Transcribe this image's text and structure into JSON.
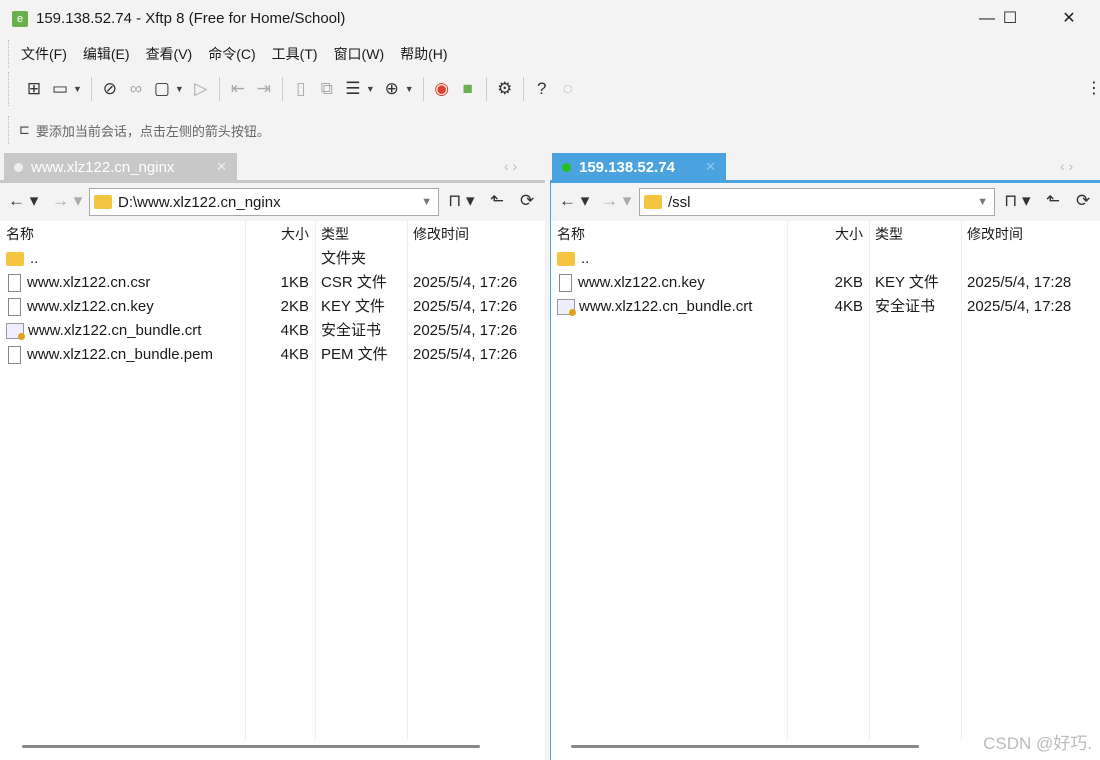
{
  "window": {
    "title": "159.138.52.74 - Xftp 8 (Free for Home/School)",
    "minimize": "—",
    "maximize": "☐",
    "close": "✕"
  },
  "menu": [
    "文件(F)",
    "编辑(E)",
    "查看(V)",
    "命令(C)",
    "工具(T)",
    "窗口(W)",
    "帮助(H)"
  ],
  "hint": "要添加当前会话，点击左侧的箭头按钮。",
  "left": {
    "tab": "www.xlz122.cn_nginx",
    "path": "D:\\www.xlz122.cn_nginx",
    "headers": [
      "名称",
      "大小",
      "类型",
      "修改时间"
    ],
    "rows": [
      {
        "name": "..",
        "size": "",
        "type": "文件夹",
        "time": "",
        "icon": "folder"
      },
      {
        "name": "www.xlz122.cn.csr",
        "size": "1KB",
        "type": "CSR 文件",
        "time": "2025/5/4, 17:26",
        "icon": "file"
      },
      {
        "name": "www.xlz122.cn.key",
        "size": "2KB",
        "type": "KEY 文件",
        "time": "2025/5/4, 17:26",
        "icon": "file"
      },
      {
        "name": "www.xlz122.cn_bundle.crt",
        "size": "4KB",
        "type": "安全证书",
        "time": "2025/5/4, 17:26",
        "icon": "cert"
      },
      {
        "name": "www.xlz122.cn_bundle.pem",
        "size": "4KB",
        "type": "PEM 文件",
        "time": "2025/5/4, 17:26",
        "icon": "file"
      }
    ]
  },
  "right": {
    "tab": "159.138.52.74",
    "path": "/ssl",
    "headers": [
      "名称",
      "大小",
      "类型",
      "修改时间"
    ],
    "rows": [
      {
        "name": "..",
        "size": "",
        "type": "",
        "time": "",
        "icon": "folder"
      },
      {
        "name": "www.xlz122.cn.key",
        "size": "2KB",
        "type": "KEY 文件",
        "time": "2025/5/4, 17:28",
        "icon": "file"
      },
      {
        "name": "www.xlz122.cn_bundle.crt",
        "size": "4KB",
        "type": "安全证书",
        "time": "2025/5/4, 17:28",
        "icon": "cert"
      }
    ]
  },
  "colors": {
    "active_tab": "#4aa3df",
    "connected": "#22c022",
    "inactive_tab": "#c8c8c8"
  },
  "watermark": "CSDN @好巧."
}
